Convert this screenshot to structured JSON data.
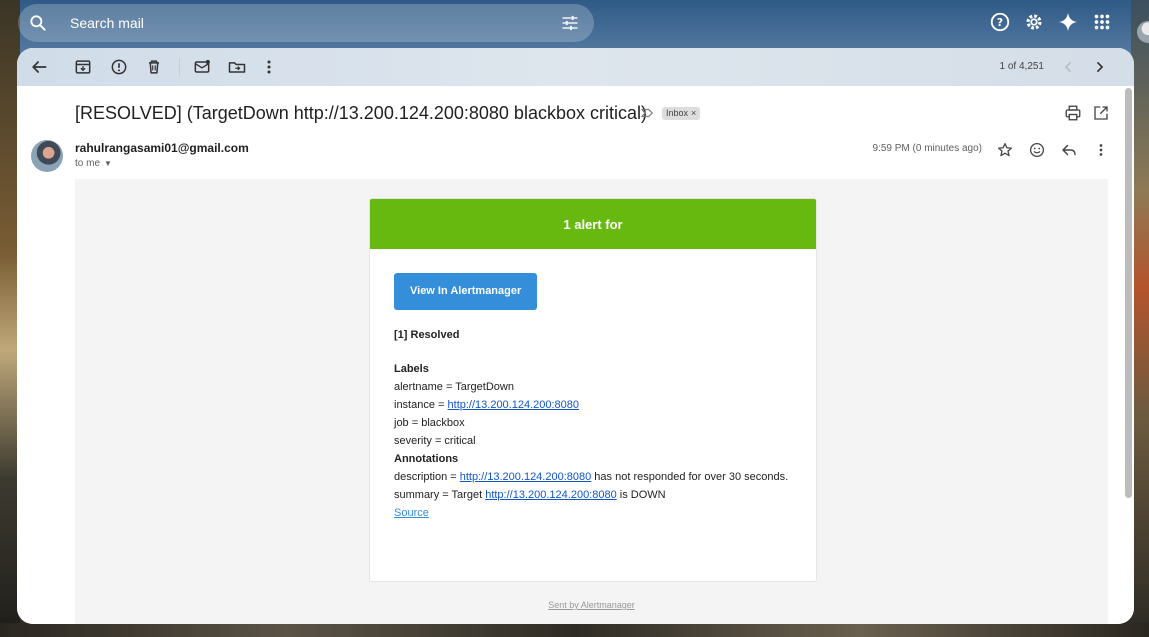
{
  "search": {
    "placeholder": "Search mail"
  },
  "toolbar": {
    "pager": "1 of 4,251"
  },
  "email": {
    "subject": "[RESOLVED] (TargetDown http://13.200.124.200:8080 blackbox critical)",
    "label": "Inbox",
    "label_close": "×",
    "sender": "rahulrangasami01@gmail.com",
    "to": "to me",
    "time": "9:59 PM (0 minutes ago)"
  },
  "body": {
    "header": "1 alert for",
    "button": "View In Alertmanager",
    "resolved": "[1] Resolved",
    "labels_heading": "Labels",
    "alertname": "alertname = TargetDown",
    "instance_prefix": "instance = ",
    "instance_link": "http://13.200.124.200:8080",
    "job": "job = blackbox",
    "severity": "severity = critical",
    "annotations_heading": "Annotations",
    "description_prefix": "description = ",
    "description_link": "http://13.200.124.200:8080",
    "description_suffix": " has not responded for over 30 seconds.",
    "summary_prefix": "summary = Target ",
    "summary_link": "http://13.200.124.200:8080",
    "summary_suffix": " is DOWN",
    "source": "Source",
    "footer": "Sent by Alertmanager"
  },
  "colors": {
    "header_green": "#68b90f",
    "button_blue": "#348eda",
    "link_blue": "#1155cc"
  }
}
